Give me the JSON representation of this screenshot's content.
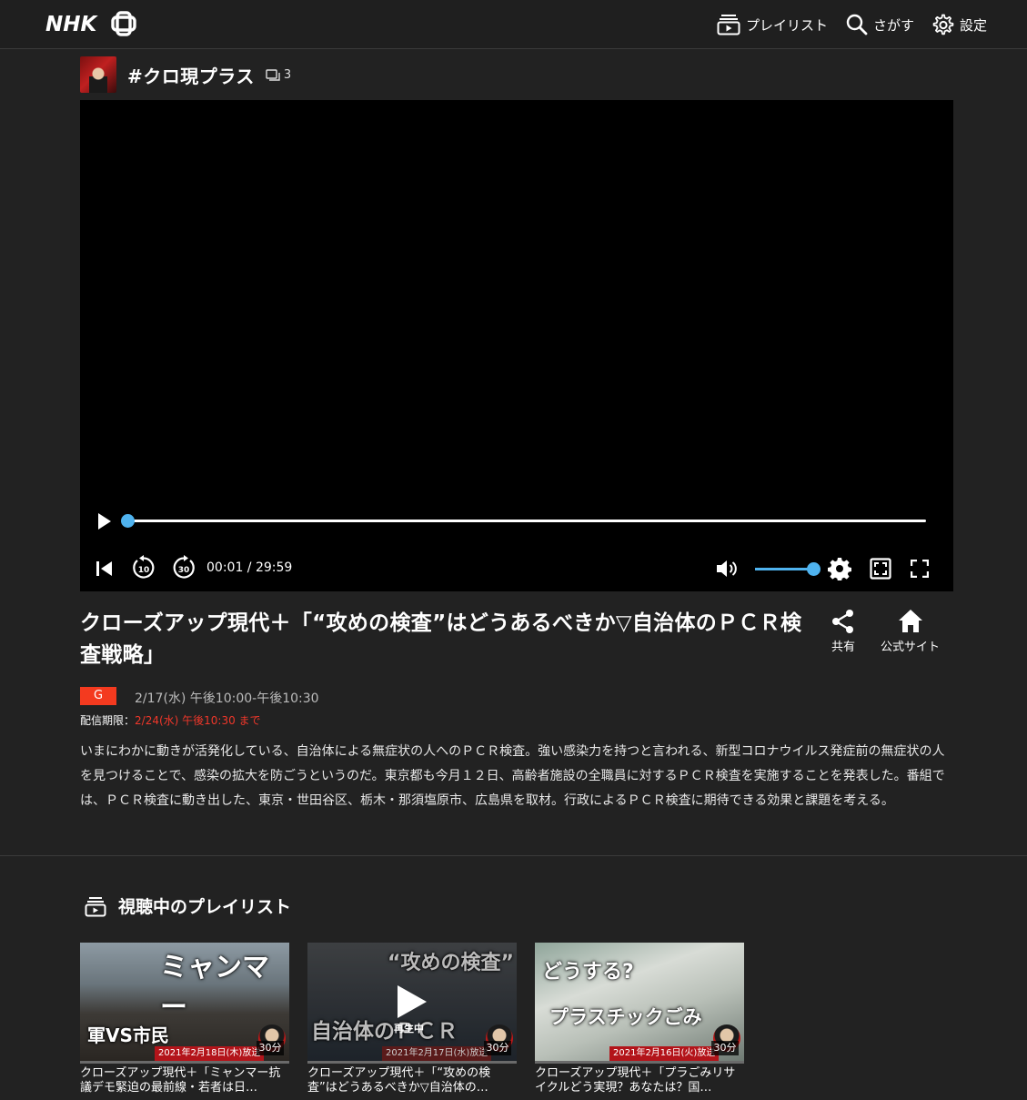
{
  "header": {
    "logo": "NHK+",
    "nav": [
      {
        "label": "プレイリスト",
        "icon": "playlist-icon"
      },
      {
        "label": "さがす",
        "icon": "search-icon"
      },
      {
        "label": "設定",
        "icon": "gear-icon"
      }
    ]
  },
  "program": {
    "title": "#クロ現プラス",
    "count": "3"
  },
  "player": {
    "time_display": "00:01 / 29:59",
    "progress_fraction": 0.0005,
    "volume_fraction": 1.0,
    "skip_back_seconds": "10",
    "skip_forward_seconds": "30"
  },
  "episode": {
    "title": "クローズアップ現代＋「“攻めの検査”はどうあるべきか▽自治体のＰＣＲ検査戦略」",
    "channel": "G",
    "broadcast": "2/17(水) 午後10:00-午後10:30",
    "deadline_label": "配信期限：",
    "deadline_value": "2/24(水) 午後10:30 まで",
    "description": "いまにわかに動きが活発化している、自治体による無症状の人へのＰＣＲ検査。強い感染力を持つと言われる、新型コロナウイルス発症前の無症状の人を見つけることで、感染の拡大を防ごうというのだ。東京都も今月１２日、高齢者施設の全職員に対するＰＣＲ検査を実施することを発表した。番組では、ＰＣＲ検査に動き出した、東京・世田谷区、栃木・那須塩原市、広島県を取材。行政によるＰＣＲ検査に期待できる効果と課題を考える。",
    "actions": [
      {
        "label": "共有",
        "icon": "share-icon"
      },
      {
        "label": "公式サイト",
        "icon": "home-icon"
      }
    ]
  },
  "playlist": {
    "heading": "視聴中のプレイリスト",
    "items": [
      {
        "caption_top": "ミャンマー",
        "caption_bottom": "軍VS市民",
        "date": "2021年2月18日(木)放送",
        "duration": "30分",
        "title": "クローズアップ現代＋「ミャンマー抗議デモ緊迫の最前線・若者は日…"
      },
      {
        "caption_top": "“攻めの検査”",
        "caption_bottom": "自治体のＰＣＲ",
        "date": "2021年2月17日(水)放送",
        "duration": "30分",
        "playing": "再生中",
        "title": "クローズアップ現代＋「“攻めの検査”はどうあるべきか▽自治体の…"
      },
      {
        "caption_top": "どうする?",
        "caption_bottom": "プラスチックごみ",
        "date": "2021年2月16日(火)放送",
        "duration": "30分",
        "title": "クローズアップ現代＋「プラごみリサイクルどう実現？あなたは？国…"
      }
    ]
  },
  "colors": {
    "background": "#222222",
    "accent": "#4fb3ef",
    "channel_badge": "#f43a1f",
    "deadline": "#f0372a"
  }
}
